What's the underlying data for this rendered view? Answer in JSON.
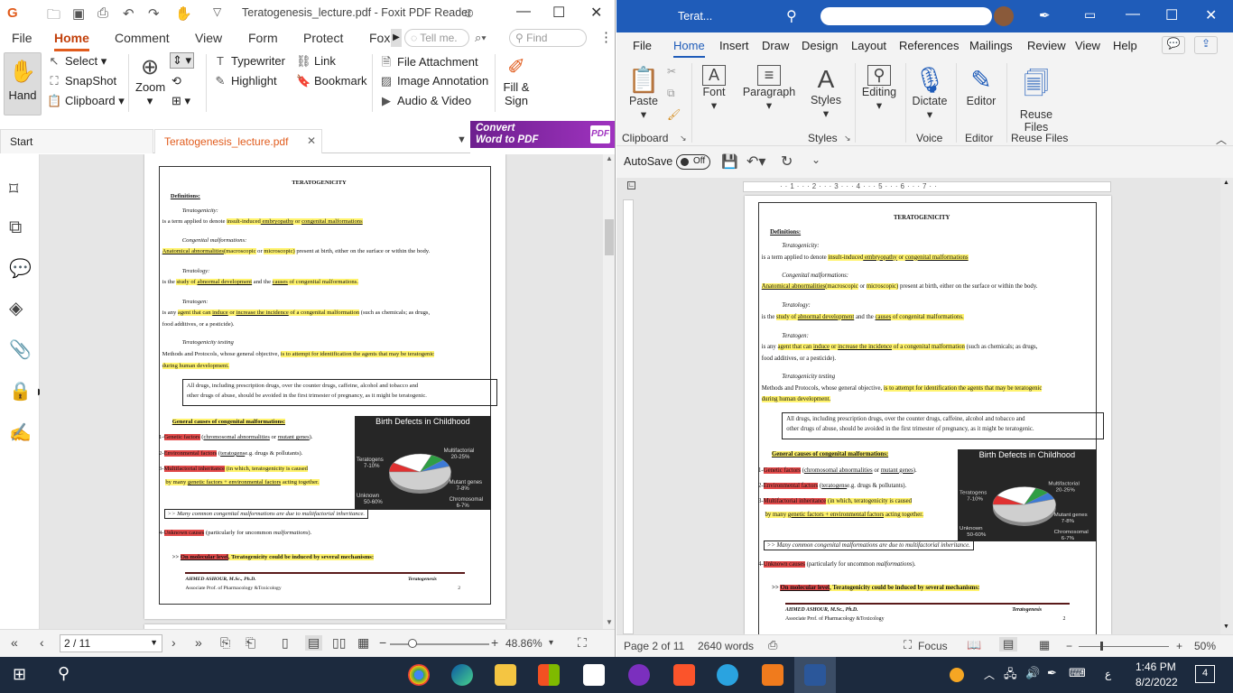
{
  "foxit": {
    "title": "Teratogenesis_lecture.pdf - Foxit PDF Reader",
    "menu": [
      "File",
      "Home",
      "Comment",
      "View",
      "Form",
      "Protect",
      "Foxit"
    ],
    "tell_me": "Tell me.",
    "find": "Find",
    "ribbon": {
      "hand": "Hand",
      "select": "Select",
      "snapshot": "SnapShot",
      "clipboard": "Clipboard",
      "zoom": "Zoom",
      "typewriter": "Typewriter",
      "highlight": "Highlight",
      "link": "Link",
      "bookmark": "Bookmark",
      "file_attachment": "File Attachment",
      "image_annotation": "Image Annotation",
      "audio_video": "Audio & Video",
      "fill_sign_1": "Fill &",
      "fill_sign_2": "Sign"
    },
    "promo_1": "Convert",
    "promo_2": "Word to PDF",
    "tabs": [
      "Start",
      "Teratogenesis_lecture.pdf"
    ],
    "page_field": "2 / 11",
    "zoom": "48.86%"
  },
  "doc": {
    "title": "TERATOGENICITY",
    "definitions": "Definitions:",
    "terato_h": "Teratogenicity:",
    "terato_l1": "is a term applied to denote ",
    "terato_l2": "insult-induced",
    "terato_l3": " embryopathy",
    "terato_l4": " or ",
    "terato_l5": "congenital malformations",
    "cm_h": "Congenital malformations:",
    "cm_l1": "Anatomical abnormalities",
    "cm_l2": "(macroscopic",
    "cm_l3": " or ",
    "cm_l4": "microscopic)",
    "cm_l5": " present at birth, either on the surface or within the body.",
    "tl_h": "Teratology:",
    "tl_l1": "is the ",
    "tl_l2": "study of ",
    "tl_l3": "abnormal development",
    "tl_l4": " and the ",
    "tl_l5": "causes",
    "tl_l6": " of congenital malformations.",
    "tg_h": "Teratogen:",
    "tg_l1": "is any ",
    "tg_l2": "agent that can ",
    "tg_l3": "induce",
    "tg_l4": " or ",
    "tg_l5": "increase the incidence",
    "tg_l6": " of a congenital malformation",
    "tg_l7": " (such as chemicals; as drugs,",
    "tg_l8": "food additives, or a pesticide).",
    "tt_h": "Teratogenicity testing",
    "tt_l1": "Methods and Protocols, whose general objective, ",
    "tt_l2": "is to attempt for identification the agents that may be teratogenic",
    "tt_l3": "during human development.",
    "box1_l1": "All drugs, including prescription drugs, over the counter drugs, caffeine, alcohol and tobacco and",
    "box1_l2": "other drugs of abuse, should be avoided in the first trimester of pregnancy, as it might be teratogenic.",
    "gc_h": "General causes of congenital malformations:",
    "gc_1a": "1-",
    "gc_1b": "Genetic factors",
    "gc_1c": " (",
    "gc_1d": "chromosomal abnormalities",
    "gc_1e": " or ",
    "gc_1f": "mutant genes",
    "gc_1g": ").",
    "gc_2a": "2-",
    "gc_2b": "Environmental factors",
    "gc_2c": " (",
    "gc_2d": "teratogens",
    "gc_2e": "e.g. drugs & pollutants).",
    "gc_3a": "3-",
    "gc_3b": "Multifactorial inheritance",
    "gc_3c": " (in which, teratogenicity is caused",
    "gc_3d": "by many ",
    "gc_3e": "genetic factors + environmental factors",
    "gc_3f": " acting together.",
    "box2": ">> Many common congenital malformations are due to multifactorial inheritance.",
    "gc_4a": "4-",
    "gc_4b": "Unknown causes",
    "gc_4c": " (particularly for uncommon ",
    "gc_4d": "malformations",
    "gc_4e": ").",
    "mol_a": ">> ",
    "mol_b": "On molecular level",
    "mol_c": ", Teratogenicity could be induced by several mechanisms:",
    "footer_author": "AHMED ASHOUR, M.Sc., Ph.D.",
    "footer_role": "Associate Prof. of Pharmacology &Toxicology",
    "footer_topic": "Teratogenesis",
    "footer_page": "2"
  },
  "chart": {
    "title": "Birth Defects in Childhood",
    "labels": [
      {
        "name": "Teratogens",
        "range": "7-10%"
      },
      {
        "name": "Multifactorial",
        "range": "20-25%"
      },
      {
        "name": "Mutant genes",
        "range": "7-8%"
      },
      {
        "name": "Chromosomal",
        "range": "6-7%"
      },
      {
        "name": "Unknown",
        "range": "50-60%"
      }
    ],
    "colors": {
      "teratogens": "#e03131",
      "multifactorial": "#ffffff",
      "mutant": "#2f9e44",
      "chromosomal": "#3d7ad6",
      "unknown": "#cfcfcf"
    }
  },
  "chart_data": {
    "type": "pie",
    "title": "Birth Defects in Childhood",
    "categories": [
      "Teratogens",
      "Multifactorial",
      "Mutant genes",
      "Chromosomal",
      "Unknown"
    ],
    "values": [
      8.5,
      22.5,
      7.5,
      6.5,
      55
    ]
  },
  "word": {
    "title": "Terat...",
    "menu": [
      "File",
      "Home",
      "Insert",
      "Draw",
      "Design",
      "Layout",
      "References",
      "Mailings",
      "Review",
      "View",
      "Help"
    ],
    "ribbon": {
      "paste": "Paste",
      "font": "Font",
      "paragraph": "Paragraph",
      "styles": "Styles",
      "editing": "Editing",
      "dictate": "Dictate",
      "editor": "Editor",
      "reuse_1": "Reuse",
      "reuse_2": "Files"
    },
    "groups": {
      "clipboard": "Clipboard",
      "styles": "Styles",
      "voice": "Voice",
      "editor": "Editor",
      "reuse": "Reuse Files"
    },
    "autosave": "AutoSave",
    "autosave_state": "Off",
    "status_page": "Page 2 of 11",
    "status_words": "2640 words",
    "focus": "Focus",
    "zoom": "50%"
  },
  "taskbar": {
    "time": "1:46 PM",
    "date": "8/2/2022",
    "lang": "ع",
    "notif": "4"
  }
}
